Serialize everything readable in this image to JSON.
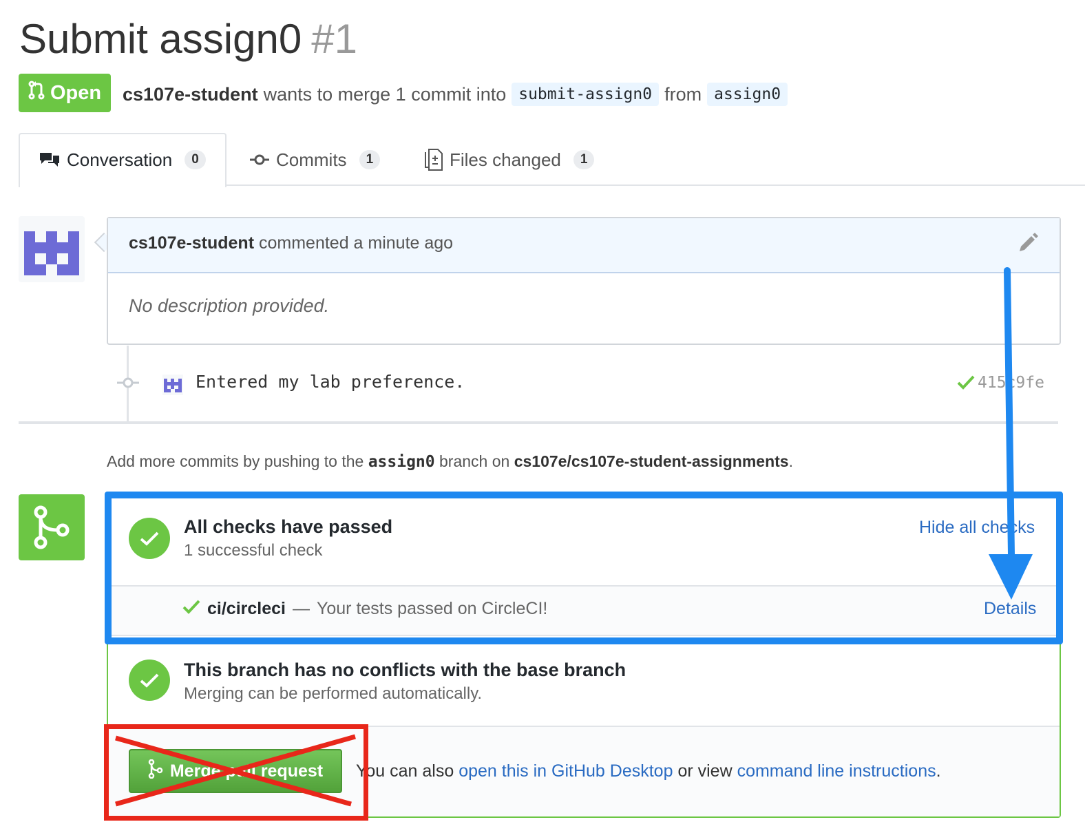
{
  "pr": {
    "title": "Submit assign0",
    "number": "#1",
    "state": "Open",
    "author": "cs107e-student",
    "merge_text": "wants to merge 1 commit into",
    "base_branch": "submit-assign0",
    "from_text": "from",
    "head_branch": "assign0"
  },
  "tabs": [
    {
      "label": "Conversation",
      "count": "0"
    },
    {
      "label": "Commits",
      "count": "1"
    },
    {
      "label": "Files changed",
      "count": "1"
    }
  ],
  "comment": {
    "author": "cs107e-student",
    "action": "commented a minute ago",
    "body": "No description provided."
  },
  "commit": {
    "message": "Entered my lab preference.",
    "sha": "415c9fe"
  },
  "push_note": {
    "prefix": "Add more commits by pushing to the",
    "branch": "assign0",
    "middle": "branch on",
    "repo": "cs107e/cs107e-student-assignments",
    "suffix": "."
  },
  "checks": {
    "title": "All checks have passed",
    "subtitle": "1 successful check",
    "toggle_label": "Hide all checks",
    "ci_name": "ci/circleci",
    "ci_separator": "—",
    "ci_message": "Your tests passed on CircleCI!",
    "details_label": "Details"
  },
  "conflicts": {
    "title": "This branch has no conflicts with the base branch",
    "subtitle": "Merging can be performed automatically."
  },
  "merge": {
    "button_label": "Merge pull request",
    "alt_prefix": "You can also",
    "desktop_link": "open this in GitHub Desktop",
    "alt_middle": "or view",
    "cli_link": "command line instructions",
    "alt_suffix": "."
  },
  "colors": {
    "success": "#6cc644",
    "link": "#2a6bc2",
    "annotation_blue": "#1e88f0",
    "annotation_red": "#e8271a"
  }
}
